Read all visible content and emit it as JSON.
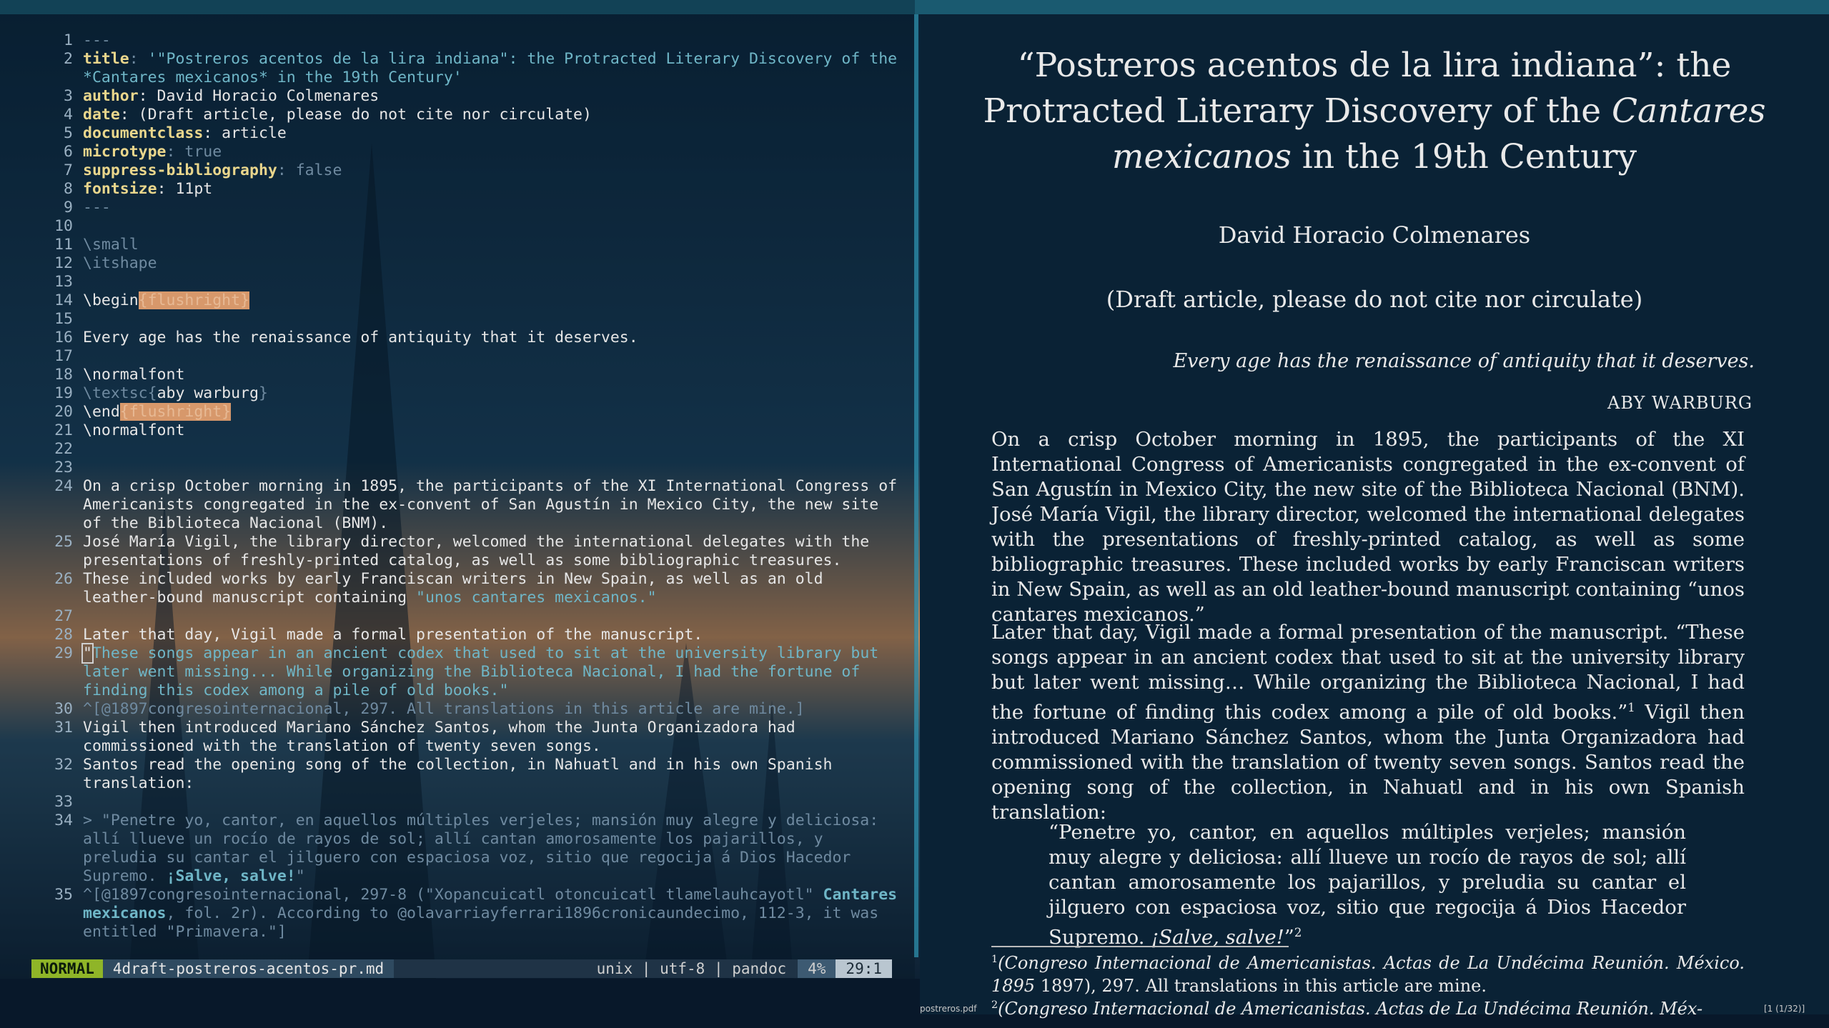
{
  "editor": {
    "lines": [
      {
        "n": "1",
        "parts": [
          {
            "t": "---",
            "c": "dim"
          }
        ]
      },
      {
        "n": "2",
        "parts": [
          {
            "t": "title",
            "c": "key"
          },
          {
            "t": ": ",
            "c": "dim"
          },
          {
            "t": "'\"Postreros acentos de la lira indiana\": the Protracted Literary Discovery of the *Cantares mexicanos* in the 19th Century'",
            "c": "str"
          }
        ]
      },
      {
        "n": "3",
        "parts": [
          {
            "t": "author",
            "c": "key"
          },
          {
            "t": ": David Horacio Colmenares",
            "c": ""
          }
        ]
      },
      {
        "n": "4",
        "parts": [
          {
            "t": "date",
            "c": "key"
          },
          {
            "t": ": (Draft article, please do not cite nor circulate)",
            "c": ""
          }
        ]
      },
      {
        "n": "5",
        "parts": [
          {
            "t": "documentclass",
            "c": "key"
          },
          {
            "t": ": article",
            "c": ""
          }
        ]
      },
      {
        "n": "6",
        "parts": [
          {
            "t": "microtype",
            "c": "key"
          },
          {
            "t": ": true",
            "c": "dim"
          }
        ]
      },
      {
        "n": "7",
        "parts": [
          {
            "t": "suppress-bibliography",
            "c": "key"
          },
          {
            "t": ": false",
            "c": "dim"
          }
        ]
      },
      {
        "n": "8",
        "parts": [
          {
            "t": "fontsize",
            "c": "key"
          },
          {
            "t": ": 11pt",
            "c": ""
          }
        ]
      },
      {
        "n": "9",
        "parts": [
          {
            "t": "---",
            "c": "dim"
          }
        ]
      },
      {
        "n": "10",
        "parts": [
          {
            "t": "",
            "c": ""
          }
        ]
      },
      {
        "n": "11",
        "parts": [
          {
            "t": "\\small",
            "c": "dim"
          }
        ]
      },
      {
        "n": "12",
        "parts": [
          {
            "t": "\\itshape",
            "c": "dim"
          }
        ]
      },
      {
        "n": "13",
        "parts": [
          {
            "t": "",
            "c": ""
          }
        ]
      },
      {
        "n": "14",
        "parts": [
          {
            "t": "\\begin",
            "c": ""
          },
          {
            "t": "{flushright}",
            "c": "hl"
          }
        ]
      },
      {
        "n": "15",
        "parts": [
          {
            "t": "",
            "c": ""
          }
        ]
      },
      {
        "n": "16",
        "parts": [
          {
            "t": "Every age has the renaissance of antiquity that it deserves.",
            "c": ""
          }
        ]
      },
      {
        "n": "17",
        "parts": [
          {
            "t": "",
            "c": ""
          }
        ]
      },
      {
        "n": "18",
        "parts": [
          {
            "t": "\\normalfont",
            "c": ""
          }
        ]
      },
      {
        "n": "19",
        "parts": [
          {
            "t": "\\textsc{",
            "c": "dim"
          },
          {
            "t": "aby warburg",
            "c": ""
          },
          {
            "t": "}",
            "c": "dim"
          }
        ]
      },
      {
        "n": "20",
        "parts": [
          {
            "t": "\\end",
            "c": ""
          },
          {
            "t": "{flushright}",
            "c": "hl"
          }
        ]
      },
      {
        "n": "21",
        "parts": [
          {
            "t": "\\normalfont",
            "c": ""
          }
        ]
      },
      {
        "n": "22",
        "parts": [
          {
            "t": "",
            "c": ""
          }
        ]
      },
      {
        "n": "23",
        "parts": [
          {
            "t": "",
            "c": ""
          }
        ]
      },
      {
        "n": "24",
        "parts": [
          {
            "t": "On a crisp October morning in 1895, the participants of the XI International Congress of Americanists congregated in the ex-convent of San Agustín in Mexico City, the new site of the Biblioteca Nacional (BNM).",
            "c": ""
          }
        ]
      },
      {
        "n": "25",
        "parts": [
          {
            "t": "José María Vigil, the library director, welcomed the international delegates with the presentations of freshly-printed catalog, as well as some bibliographic treasures.",
            "c": ""
          }
        ]
      },
      {
        "n": "26",
        "parts": [
          {
            "t": "These included works by early Franciscan writers in New Spain, as well as an old leather-bound manuscript containing ",
            "c": ""
          },
          {
            "t": "\"unos cantares mexicanos.\"",
            "c": "str"
          }
        ]
      },
      {
        "n": "27",
        "parts": [
          {
            "t": "",
            "c": ""
          }
        ]
      },
      {
        "n": "28",
        "parts": [
          {
            "t": "Later that day, Vigil made a formal presentation of the manuscript.",
            "c": ""
          }
        ]
      },
      {
        "n": "29",
        "parts": [
          {
            "t": "\"",
            "c": "cursor"
          },
          {
            "t": "These songs appear in an ancient codex that used to sit at the university library but later went missing... While organizing the Biblioteca Nacional, I had the fortune of finding this codex among a pile of old books.\"",
            "c": "str"
          }
        ]
      },
      {
        "n": "30",
        "parts": [
          {
            "t": "^[@1897congresointernacional, 297. All translations in this article are mine.]",
            "c": "dim"
          }
        ]
      },
      {
        "n": "31",
        "parts": [
          {
            "t": "Vigil then introduced Mariano Sánchez Santos, whom the Junta Organizadora had commissioned with the translation of twenty seven songs.",
            "c": ""
          }
        ]
      },
      {
        "n": "32",
        "parts": [
          {
            "t": "Santos read the opening song of the collection, in Nahuatl and in his own Spanish translation:",
            "c": ""
          }
        ]
      },
      {
        "n": "33",
        "parts": [
          {
            "t": "",
            "c": ""
          }
        ]
      },
      {
        "n": "34",
        "parts": [
          {
            "t": "> \"Penetre yo, cantor, en aquellos múltiples verjeles; mansión muy alegre y deliciosa: allí llueve un rocío de rayos de sol; allí cantan amorosamente los pajarillos, y preludia su cantar el jilguero con espaciosa voz, sitio que regocija á Dios Hacedor Supremo. ",
            "c": "dim"
          },
          {
            "t": "¡Salve, salve!",
            "c": "str bold"
          },
          {
            "t": "\"",
            "c": "dim"
          }
        ]
      },
      {
        "n": "35",
        "parts": [
          {
            "t": "^[@1897congresointernacional, 297-8 (\"Xopancuicatl otoncuicatl tlamelauhcayotl\" ",
            "c": "dim"
          },
          {
            "t": "Cantares mexicanos",
            "c": "str bold"
          },
          {
            "t": ", fol. 2r). According to @olavarriayferrari1896cronicaundecimo, 112-3, it was entitled \"Primavera.\"]",
            "c": "dim"
          }
        ]
      }
    ]
  },
  "status": {
    "mode": "NORMAL",
    "file": "4draft-postreros-acentos-pr.md",
    "info": "unix | utf-8 | pandoc",
    "percent": "4%",
    "position": "29:1"
  },
  "pdf": {
    "title_1": "“Postreros acentos de la lira indiana”: the",
    "title_2a": "Protracted Literary Discovery of the ",
    "title_2b": "Cantares",
    "title_3a": "mexicanos",
    "title_3b": " in the 19th Century",
    "author": "David Horacio Colmenares",
    "date": "(Draft article, please do not cite nor circulate)",
    "epigraph": "Every age has the renaissance of antiquity that it deserves.",
    "epigraph_author": "ABY WARBURG",
    "para1": "On a crisp October morning in 1895, the participants of the XI International Congress of Americanists congregated in the ex-convent of San Agustín in Mexico City, the new site of the Biblioteca Nacional (BNM). José María Vigil, the library director, welcomed the international delegates with the presentations of freshly-printed catalog, as well as some bibliographic treasures. These included works by early Franciscan writers in New Spain, as well as an old leather-bound manuscript containing “unos cantares mexicanos.”",
    "para2a": "Later that day, Vigil made a formal presentation of the manuscript. “These songs appear in an ancient codex that used to sit at the university library but later went missing… While organizing the Biblioteca Nacional, I had the fortune of finding this codex among a pile of old books.”",
    "fnref1": "1",
    "para2b": " Vigil then introduced Mariano Sánchez Santos, whom the Junta Organizadora had commissioned with the translation of twenty seven songs. Santos read the opening song of the collection, in Nahuatl and in his own Spanish translation:",
    "quote_a": "“Penetre yo, cantor, en aquellos múltiples verjeles; mansión muy alegre y deliciosa: allí llueve un rocío de rayos de sol; allí cantan amorosamente los pajarillos, y preludia su cantar el jilguero con espaciosa voz, sitio que regocija á Dios Hacedor Supremo. ",
    "quote_b": "¡Salve, salve!",
    "quote_c": "”",
    "fnref2": "2",
    "fn1_num": "1",
    "fn1_it": "(Congreso Internacional de Americanistas. Actas de La Undécima Reunión. México. 1895",
    "fn1_rest": " 1897), 297. All translations in this article are mine.",
    "fn2_num": "2",
    "fn2_it": "(Congreso Internacional de Americanistas. Actas de La Undécima Reunión. Méx-",
    "filename": "postreros.pdf",
    "page": "[1 (1/32)]"
  }
}
